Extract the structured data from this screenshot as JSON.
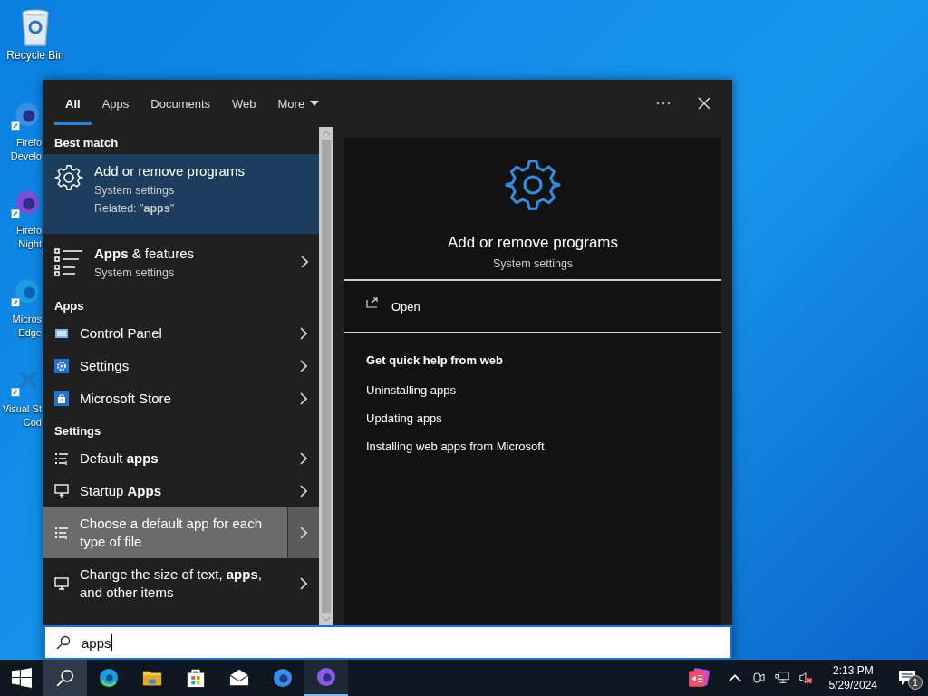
{
  "desktop_icons": [
    {
      "lines": [
        "Recycle Bin"
      ]
    },
    {
      "lines": [
        "Firefo",
        "Develo"
      ]
    },
    {
      "lines": [
        "Firefo",
        "Night"
      ]
    },
    {
      "lines": [
        "Micros",
        "Edge"
      ]
    },
    {
      "lines": [
        "Visual St",
        "Cod"
      ]
    }
  ],
  "tabs": [
    {
      "label": "All",
      "selected": true,
      "kind": "plain"
    },
    {
      "label": "Apps",
      "selected": false,
      "kind": "plain"
    },
    {
      "label": "Documents",
      "selected": false,
      "kind": "plain"
    },
    {
      "label": "Web",
      "selected": false,
      "kind": "plain"
    },
    {
      "label": "More",
      "selected": false,
      "kind": "dropdown"
    }
  ],
  "results": [
    {
      "kind": "header",
      "text": "Best match"
    },
    {
      "kind": "best",
      "title": "Add or remove programs",
      "subtitle": "System settings",
      "related": "Related: \"**apps**\"",
      "selected": true
    },
    {
      "kind": "large",
      "title": "**Apps** & features",
      "subtitle": "System settings",
      "selected": false
    },
    {
      "kind": "header",
      "text": "Apps"
    },
    {
      "kind": "item",
      "title": "Control Panel",
      "selected": false
    },
    {
      "kind": "item",
      "title": "Settings",
      "selected": false
    },
    {
      "kind": "item",
      "title": "Microsoft Store",
      "selected": false
    },
    {
      "kind": "header",
      "text": "Settings"
    },
    {
      "kind": "item",
      "title": "Default **apps**",
      "selected": false
    },
    {
      "kind": "item",
      "title": "Startup **Apps**",
      "selected": false
    },
    {
      "kind": "item",
      "title": "Choose a default app for each type of file",
      "selected": true
    },
    {
      "kind": "item",
      "title": "Change the size of text, **apps**, and other items",
      "selected": false
    }
  ],
  "preview": {
    "title": "Add or remove programs",
    "subtitle": "System settings",
    "action": "Open",
    "help_heading": "Get quick help from web",
    "links": [
      "Uninstalling apps",
      "Updating apps",
      "Installing web apps from Microsoft"
    ]
  },
  "search": {
    "value": "apps"
  },
  "taskbar": {
    "apps": [
      {
        "selected": false,
        "running": false
      },
      {
        "selected": true,
        "running": false
      },
      {
        "selected": false,
        "running": false
      },
      {
        "selected": false,
        "running": false
      },
      {
        "selected": false,
        "running": false
      },
      {
        "selected": false,
        "running": false
      },
      {
        "selected": false,
        "running": false
      },
      {
        "selected": false,
        "running": true
      }
    ],
    "time": "2:13 PM",
    "date": "5/29/2024",
    "notification_count": "1"
  }
}
